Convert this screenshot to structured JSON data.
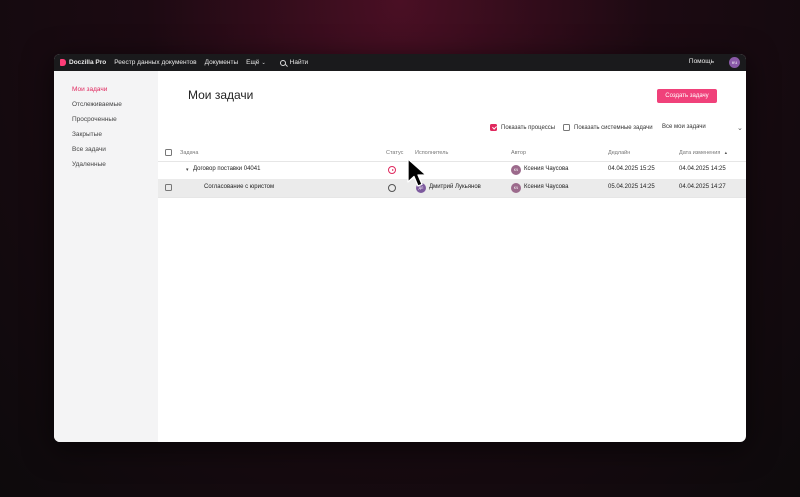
{
  "topbar": {
    "app_name": "Doczilla Pro",
    "nav": [
      "Реестр данных документов",
      "Документы",
      "Ещё"
    ],
    "search_label": "Найти",
    "help_label": "Помощь",
    "user_initials": "КЧ"
  },
  "sidebar": {
    "items": [
      {
        "label": "Мои задачи",
        "active": true
      },
      {
        "label": "Отслеживаемые",
        "active": false
      },
      {
        "label": "Просроченные",
        "active": false
      },
      {
        "label": "Закрытые",
        "active": false
      },
      {
        "label": "Все задачи",
        "active": false
      },
      {
        "label": "Удаленные",
        "active": false
      }
    ]
  },
  "page": {
    "title": "Мои задачи",
    "create_button": "Создать задачу"
  },
  "filters": {
    "show_processes_label": "Показать процессы",
    "show_processes_checked": true,
    "show_system_label": "Показать системные задачи",
    "show_system_checked": false,
    "scope_selected": "Все мои задачи"
  },
  "table": {
    "headers": {
      "task": "Задача",
      "status": "Статус",
      "assignee": "Исполнитель",
      "author": "Автор",
      "deadline": "Дедлайн",
      "modified": "Дата изменения",
      "sort_indicator": "▲"
    },
    "rows": [
      {
        "task": "Договор поставки 04041",
        "expanded": true,
        "status": "in-progress",
        "assignee_name": "",
        "assignee_initials": "",
        "author_name": "Ксения Чаусова",
        "author_initials": "КЧ",
        "deadline": "04.04.2025 15:25",
        "modified": "04.04.2025 14:25"
      },
      {
        "task": "Согласование с юристом",
        "expanded": false,
        "status": "open",
        "assignee_name": "Дмитрий Лукьянов",
        "assignee_initials": "ДЛ",
        "author_name": "Ксения Чаусова",
        "author_initials": "КЧ",
        "deadline": "05.04.2025 14:25",
        "modified": "04.04.2025 14:27"
      }
    ]
  },
  "colors": {
    "accent": "#e0285e",
    "button": "#f0417a",
    "topbar": "#1a1a1c",
    "sidebar": "#f4f4f5"
  }
}
